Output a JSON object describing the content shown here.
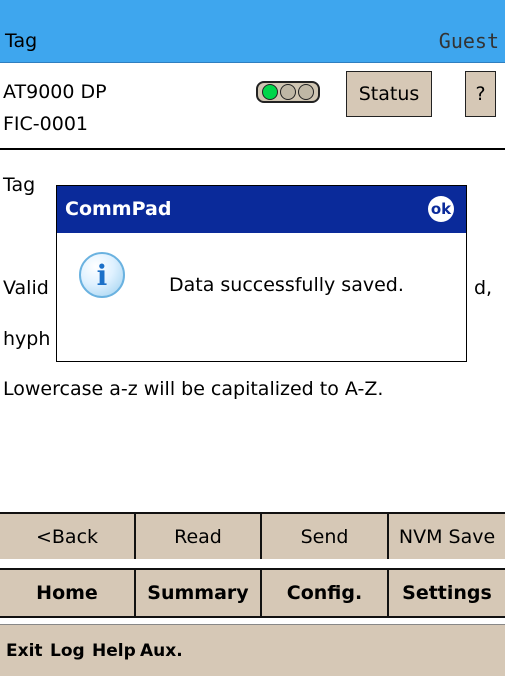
{
  "titlebar": {
    "title": "Tag",
    "user": "Guest"
  },
  "device": {
    "model": "AT9000 DP",
    "tag": "FIC-0001",
    "status_button": "Status",
    "help_button": "?"
  },
  "content": {
    "line1": "Tag",
    "line2_left": "Valid",
    "line2_right": "d,",
    "line3": "hyph",
    "line4": "Lowercase a-z will be capitalized to A-Z."
  },
  "dialog": {
    "title": "CommPad",
    "ok": "ok",
    "message": "Data successfully saved.",
    "icon": "info-icon"
  },
  "actions": [
    "<Back",
    "Read",
    "Send",
    "NVM Save"
  ],
  "nav": [
    "Home",
    "Summary",
    "Config.",
    "Settings"
  ],
  "menu": [
    "Exit",
    "Log",
    "Help",
    "Aux."
  ],
  "colors": {
    "titlebar": "#3ea6ee",
    "dialog_header": "#0a2a9a",
    "button": "#d6c8b6",
    "status_led": "#00d64a"
  }
}
